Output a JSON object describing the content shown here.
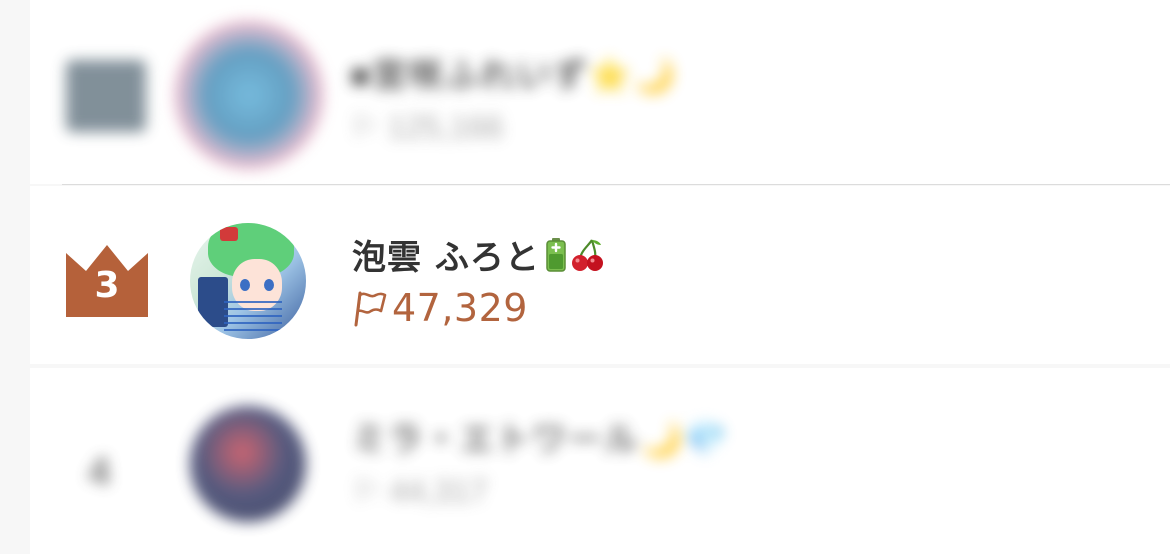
{
  "ranking": {
    "top_row": {
      "name": "■宮咲ふれいず⭐🌙",
      "count": "⚐ 125,166"
    },
    "current": {
      "rank": "3",
      "name": "泡雲 ふろと",
      "badges": [
        "battery-icon",
        "cherry-icon"
      ],
      "count": "47,329",
      "count_icon": "flag-icon",
      "count_color": "#b2643e",
      "crown_color": "#b5613a"
    },
    "bottom_row": {
      "rank": "4",
      "name": "ミラ・エトワール🌙💎",
      "count": "⚐ 44,317"
    }
  }
}
